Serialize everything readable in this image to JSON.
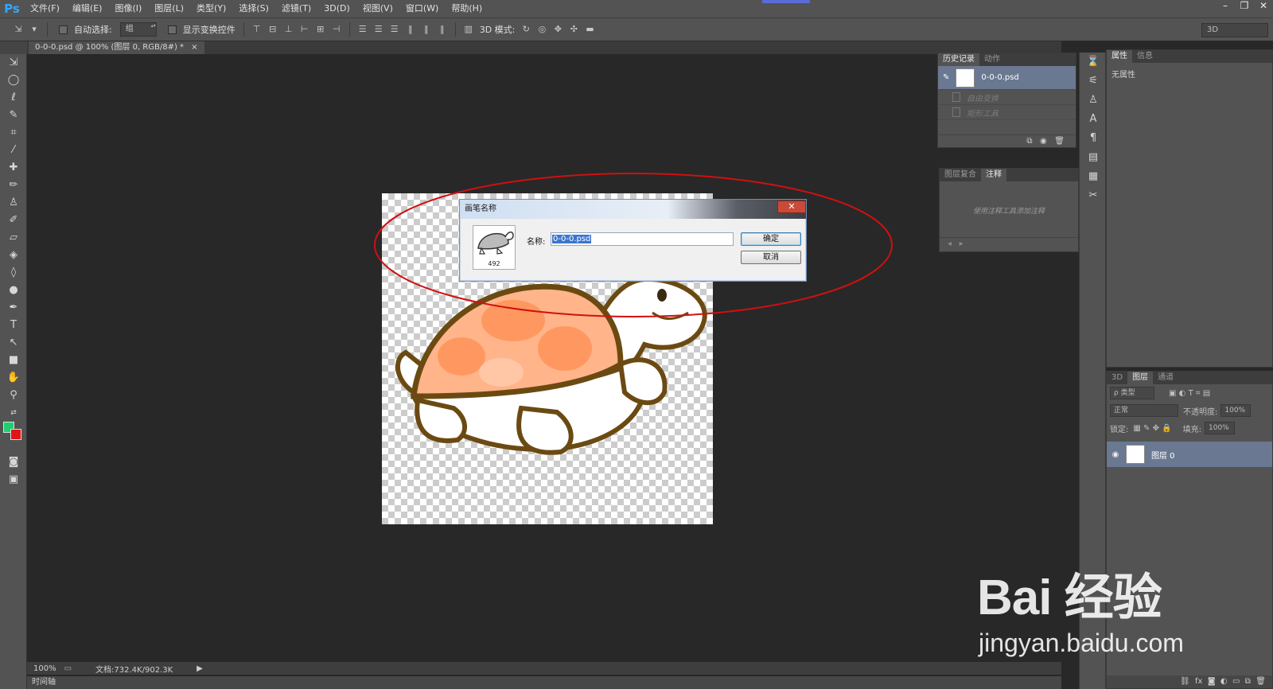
{
  "app": {
    "logo": "Ps",
    "menu": [
      "文件(F)",
      "编辑(E)",
      "图像(I)",
      "图层(L)",
      "类型(Y)",
      "选择(S)",
      "滤镜(T)",
      "3D(D)",
      "视图(V)",
      "窗口(W)",
      "帮助(H)"
    ],
    "window_controls": [
      "–",
      "❐",
      "✕"
    ]
  },
  "options": {
    "auto_select_label": "自动选择:",
    "auto_select_value": "组",
    "show_transform_label": "显示变换控件",
    "mode_3d_label": "3D 模式:",
    "workspace": "3D"
  },
  "document": {
    "tab_title": "0-0-0.psd @ 100% (图层 0, RGB/8#) *",
    "zoom": "100%",
    "doc_size": "文档:732.4K/902.3K",
    "timeline": "时间轴"
  },
  "history_panel": {
    "tabs": [
      "历史记录",
      "动作"
    ],
    "snapshot": "0-0-0.psd",
    "steps": [
      "自由变换",
      "矩形工具"
    ]
  },
  "notes_panel": {
    "tabs": [
      "图层复合",
      "注释"
    ],
    "hint": "使用注释工具添加注释"
  },
  "properties_panel": {
    "tabs": [
      "属性",
      "信息"
    ],
    "empty_text": "无属性"
  },
  "layers_panel": {
    "tabs": [
      "3D",
      "图层",
      "通道"
    ],
    "filter": "ρ 类型",
    "blend_mode": "正常",
    "opacity_label": "不透明度:",
    "opacity_value": "100%",
    "lock_label": "锁定:",
    "fill_label": "填充:",
    "fill_value": "100%",
    "layer_name": "图层 0"
  },
  "dialog": {
    "title": "画笔名称",
    "brush_size": "492",
    "name_label": "名称:",
    "name_value": "0-0-0.psd",
    "ok": "确定",
    "cancel": "取消"
  },
  "watermark": {
    "brand": "Bai 经验",
    "url": "jingyan.baidu.com"
  },
  "annotation_color": "#d01010"
}
